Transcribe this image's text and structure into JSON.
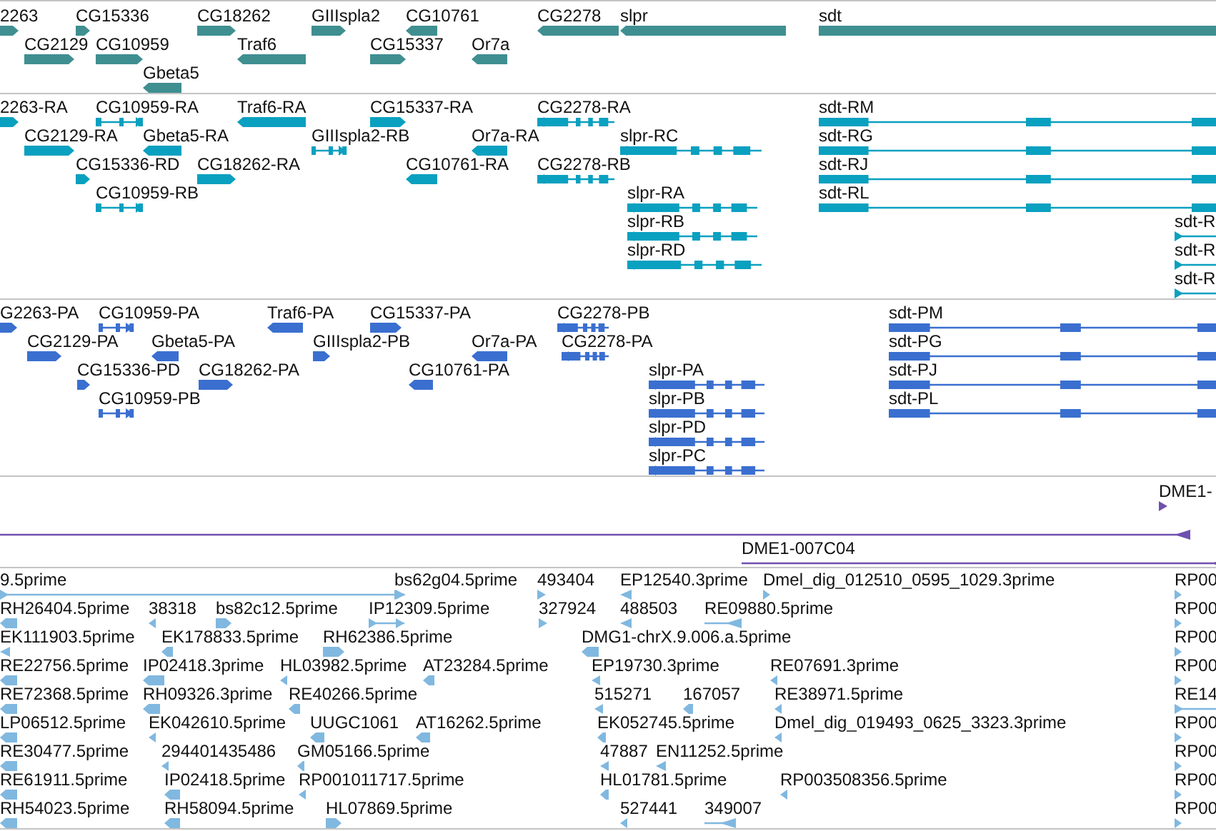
{
  "tracks": [
    {
      "color": "#3f8f91",
      "features": [
        {
          "label": "2263",
          "reverse": false,
          "kind": "block"
        },
        {
          "label": "CG15336",
          "reverse": false,
          "kind": "block"
        },
        {
          "label": "CG18262",
          "reverse": false,
          "kind": "block"
        },
        {
          "label": "GIIIspla2",
          "reverse": false,
          "kind": "block"
        },
        {
          "label": "CG10761",
          "reverse": true,
          "kind": "block"
        },
        {
          "label": "CG2278",
          "reverse": true,
          "kind": "block"
        },
        {
          "label": "slpr",
          "reverse": true,
          "kind": "block"
        },
        {
          "label": "sdt",
          "reverse": false,
          "kind": "block"
        },
        {
          "label": "CG2129",
          "reverse": false,
          "kind": "block"
        },
        {
          "label": "CG10959",
          "reverse": false,
          "kind": "block"
        },
        {
          "label": "Traf6",
          "reverse": true,
          "kind": "block"
        },
        {
          "label": "CG15337",
          "reverse": false,
          "kind": "block"
        },
        {
          "label": "Or7a",
          "reverse": true,
          "kind": "block"
        },
        {
          "label": "Gbeta5",
          "reverse": true,
          "kind": "block"
        }
      ]
    },
    {
      "color": "#0aa0c0",
      "features": [
        {
          "label": "2263-RA",
          "reverse": false,
          "kind": "block"
        },
        {
          "label": "CG10959-RA",
          "reverse": false,
          "kind": "spliced"
        },
        {
          "label": "Traf6-RA",
          "reverse": true,
          "kind": "block"
        },
        {
          "label": "CG15337-RA",
          "reverse": false,
          "kind": "block"
        },
        {
          "label": "CG2278-RA",
          "reverse": true,
          "kind": "spliced"
        },
        {
          "label": "sdt-RM",
          "reverse": false,
          "kind": "spliced"
        },
        {
          "label": "CG2129-RA",
          "reverse": false,
          "kind": "block"
        },
        {
          "label": "Gbeta5-RA",
          "reverse": true,
          "kind": "block"
        },
        {
          "label": "GIIIspla2-RB",
          "reverse": false,
          "kind": "spliced"
        },
        {
          "label": "Or7a-RA",
          "reverse": true,
          "kind": "block"
        },
        {
          "label": "slpr-RC",
          "reverse": true,
          "kind": "spliced"
        },
        {
          "label": "sdt-RG",
          "reverse": false,
          "kind": "spliced"
        },
        {
          "label": "CG15336-RD",
          "reverse": false,
          "kind": "block"
        },
        {
          "label": "CG18262-RA",
          "reverse": false,
          "kind": "block"
        },
        {
          "label": "CG10761-RA",
          "reverse": true,
          "kind": "block"
        },
        {
          "label": "CG2278-RB",
          "reverse": true,
          "kind": "spliced"
        },
        {
          "label": "sdt-RJ",
          "reverse": false,
          "kind": "spliced"
        },
        {
          "label": "CG10959-RB",
          "reverse": false,
          "kind": "spliced"
        },
        {
          "label": "slpr-RA",
          "reverse": true,
          "kind": "spliced"
        },
        {
          "label": "sdt-RL",
          "reverse": false,
          "kind": "spliced"
        },
        {
          "label": "slpr-RB",
          "reverse": true,
          "kind": "spliced"
        },
        {
          "label": "sdt-R",
          "reverse": false,
          "kind": "line"
        },
        {
          "label": "slpr-RD",
          "reverse": true,
          "kind": "spliced"
        },
        {
          "label": "sdt-R",
          "reverse": false,
          "kind": "line"
        },
        {
          "label": "sdt-R",
          "reverse": false,
          "kind": "line"
        }
      ]
    },
    {
      "color": "#3a6fd0",
      "features": [
        {
          "label": "G2263-PA",
          "reverse": false,
          "kind": "block"
        },
        {
          "label": "CG10959-PA",
          "reverse": false,
          "kind": "spliced"
        },
        {
          "label": "Traf6-PA",
          "reverse": true,
          "kind": "block"
        },
        {
          "label": "CG15337-PA",
          "reverse": false,
          "kind": "block"
        },
        {
          "label": "CG2278-PB",
          "reverse": true,
          "kind": "spliced"
        },
        {
          "label": "sdt-PM",
          "reverse": false,
          "kind": "spliced"
        },
        {
          "label": "CG2129-PA",
          "reverse": false,
          "kind": "block"
        },
        {
          "label": "Gbeta5-PA",
          "reverse": true,
          "kind": "block"
        },
        {
          "label": "GIIIspla2-PB",
          "reverse": false,
          "kind": "block"
        },
        {
          "label": "Or7a-PA",
          "reverse": true,
          "kind": "block"
        },
        {
          "label": "CG2278-PA",
          "reverse": true,
          "kind": "spliced"
        },
        {
          "label": "sdt-PG",
          "reverse": false,
          "kind": "spliced"
        },
        {
          "label": "CG15336-PD",
          "reverse": false,
          "kind": "block"
        },
        {
          "label": "CG18262-PA",
          "reverse": false,
          "kind": "block"
        },
        {
          "label": "CG10761-PA",
          "reverse": true,
          "kind": "block"
        },
        {
          "label": "slpr-PA",
          "reverse": true,
          "kind": "spliced"
        },
        {
          "label": "sdt-PJ",
          "reverse": false,
          "kind": "spliced"
        },
        {
          "label": "CG10959-PB",
          "reverse": false,
          "kind": "spliced"
        },
        {
          "label": "slpr-PB",
          "reverse": true,
          "kind": "spliced"
        },
        {
          "label": "sdt-PL",
          "reverse": false,
          "kind": "spliced"
        },
        {
          "label": "slpr-PD",
          "reverse": true,
          "kind": "spliced"
        },
        {
          "label": "slpr-PC",
          "reverse": true,
          "kind": "spliced"
        }
      ]
    },
    {
      "color": "#7050b0",
      "features": [
        {
          "label": "DME1-",
          "reverse": false,
          "kind": "marker"
        },
        {
          "reverse": true,
          "kind": "line"
        },
        {
          "label": "DME1-007C04",
          "reverse": true,
          "kind": "line"
        }
      ]
    },
    {
      "color": "#80b8e0",
      "features": [
        {
          "label": "9.5prime",
          "reverse": false,
          "kind": "line"
        },
        {
          "label": "bs62g04.5prime",
          "reverse": false,
          "kind": "marker"
        },
        {
          "label": "493404",
          "reverse": false,
          "kind": "marker"
        },
        {
          "label": "EP12540.3prime",
          "reverse": true,
          "kind": "marker"
        },
        {
          "label": "Dmel_dig_012510_0595_1029.3prime",
          "reverse": false,
          "kind": "marker"
        },
        {
          "label": "RP00",
          "reverse": false,
          "kind": "marker"
        },
        {
          "label": "RH26404.5prime",
          "reverse": true,
          "kind": "block"
        },
        {
          "label": "38318",
          "reverse": true,
          "kind": "marker"
        },
        {
          "label": "bs82c12.5prime",
          "reverse": false,
          "kind": "block"
        },
        {
          "label": "IP12309.5prime",
          "reverse": false,
          "kind": "line"
        },
        {
          "label": "327924",
          "reverse": false,
          "kind": "marker"
        },
        {
          "label": "488503",
          "reverse": true,
          "kind": "marker"
        },
        {
          "label": "RE09880.5prime",
          "reverse": true,
          "kind": "line"
        },
        {
          "label": "RP00",
          "reverse": false,
          "kind": "marker"
        },
        {
          "label": "EK111903.5prime",
          "reverse": true,
          "kind": "marker"
        },
        {
          "label": "EK178833.5prime",
          "reverse": true,
          "kind": "block"
        },
        {
          "label": "RH62386.5prime",
          "reverse": false,
          "kind": "block"
        },
        {
          "label": "DMG1-chrX.9.006.a.5prime",
          "reverse": true,
          "kind": "block"
        },
        {
          "label": "RP00",
          "reverse": false,
          "kind": "marker"
        },
        {
          "label": "RE22756.5prime",
          "reverse": true,
          "kind": "block"
        },
        {
          "label": "IP02418.3prime",
          "reverse": true,
          "kind": "block"
        },
        {
          "label": "HL03982.5prime",
          "reverse": true,
          "kind": "marker"
        },
        {
          "label": "AT23284.5prime",
          "reverse": true,
          "kind": "block"
        },
        {
          "label": "EP19730.3prime",
          "reverse": true,
          "kind": "marker"
        },
        {
          "label": "RE07691.3prime",
          "reverse": true,
          "kind": "marker"
        },
        {
          "label": "RP00",
          "reverse": false,
          "kind": "marker"
        },
        {
          "label": "RE72368.5prime",
          "reverse": true,
          "kind": "block"
        },
        {
          "label": "RH09326.3prime",
          "reverse": true,
          "kind": "block"
        },
        {
          "label": "RE40266.5prime",
          "reverse": true,
          "kind": "block"
        },
        {
          "label": "515271",
          "reverse": true,
          "kind": "marker"
        },
        {
          "label": "167057",
          "reverse": true,
          "kind": "block"
        },
        {
          "label": "RE38971.5prime",
          "reverse": true,
          "kind": "marker"
        },
        {
          "label": "RE14",
          "reverse": false,
          "kind": "line"
        },
        {
          "label": "LP06512.5prime",
          "reverse": true,
          "kind": "block"
        },
        {
          "label": "EK042610.5prime",
          "reverse": true,
          "kind": "marker"
        },
        {
          "label": "UUGC1061",
          "reverse": true,
          "kind": "block"
        },
        {
          "label": "AT16262.5prime",
          "reverse": true,
          "kind": "block"
        },
        {
          "label": "EK052745.5prime",
          "reverse": true,
          "kind": "block"
        },
        {
          "label": "Dmel_dig_019493_0625_3323.3prime",
          "reverse": true,
          "kind": "marker"
        },
        {
          "label": "RP00",
          "reverse": false,
          "kind": "marker"
        },
        {
          "label": "RE30477.5prime",
          "reverse": true,
          "kind": "block"
        },
        {
          "label": "294401435486",
          "reverse": true,
          "kind": "marker"
        },
        {
          "label": "GM05166.5prime",
          "reverse": true,
          "kind": "block"
        },
        {
          "label": "47887",
          "reverse": true,
          "kind": "marker"
        },
        {
          "label": "EN11252.5prime",
          "reverse": true,
          "kind": "marker"
        },
        {
          "label": "RP00",
          "reverse": false,
          "kind": "marker"
        },
        {
          "label": "RE61911.5prime",
          "reverse": true,
          "kind": "block"
        },
        {
          "label": "IP02418.5prime",
          "reverse": true,
          "kind": "block"
        },
        {
          "label": "RP001011717.5prime",
          "reverse": true,
          "kind": "marker"
        },
        {
          "label": "HL01781.5prime",
          "reverse": true,
          "kind": "block"
        },
        {
          "label": "RP003508356.5prime",
          "reverse": true,
          "kind": "marker"
        },
        {
          "label": "RP00",
          "reverse": false,
          "kind": "marker"
        },
        {
          "label": "RH54023.5prime",
          "reverse": true,
          "kind": "block"
        },
        {
          "label": "RH58094.5prime",
          "reverse": true,
          "kind": "block"
        },
        {
          "label": "HL07869.5prime",
          "reverse": false,
          "kind": "block"
        },
        {
          "label": "527441",
          "reverse": true,
          "kind": "marker"
        },
        {
          "label": "349007",
          "reverse": true,
          "kind": "line"
        },
        {
          "label": "RP00",
          "reverse": false,
          "kind": "marker"
        }
      ]
    }
  ]
}
